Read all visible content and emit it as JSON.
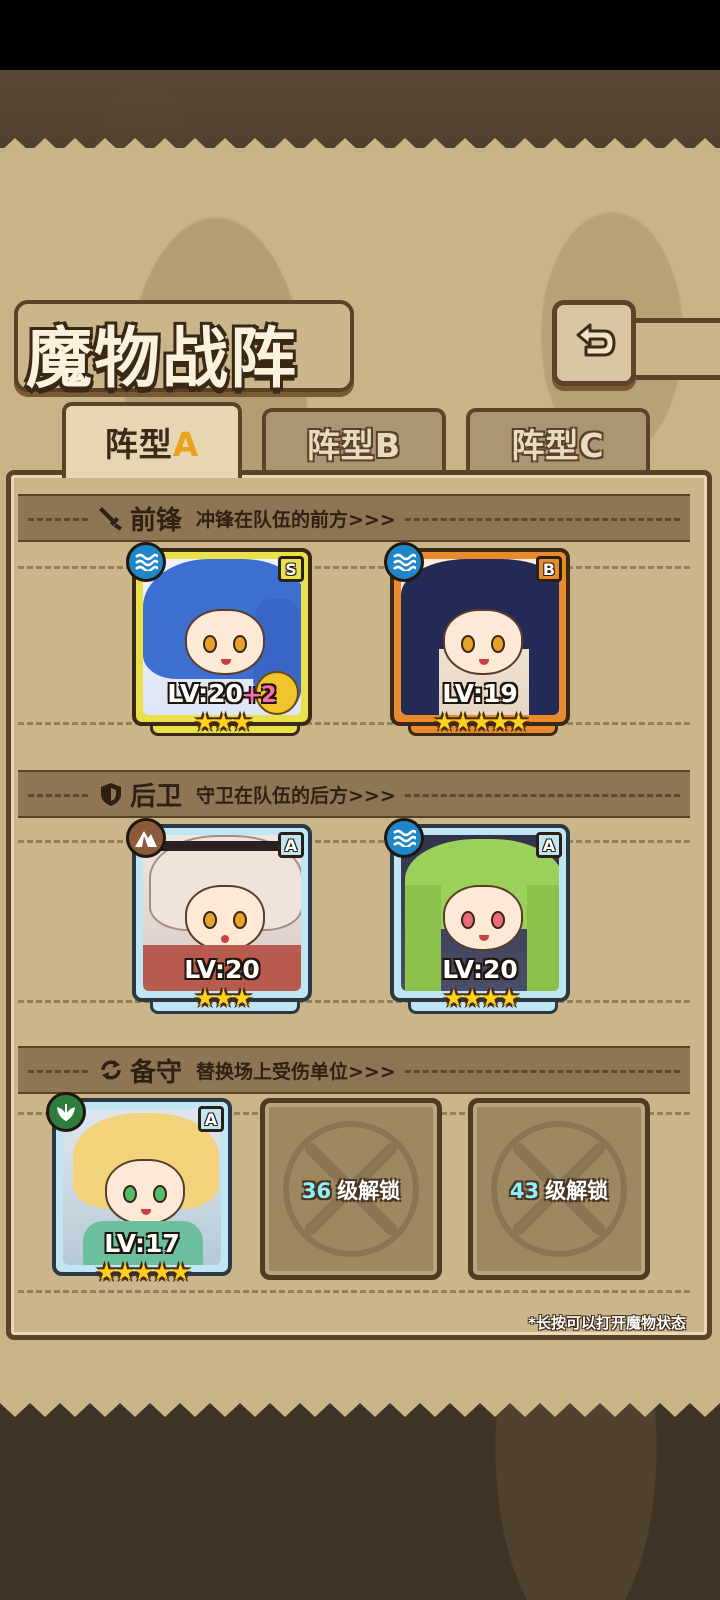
{
  "title": "魔物战阵",
  "tabs": [
    {
      "label": "阵型",
      "letter": "A",
      "active": true
    },
    {
      "label": "阵型",
      "letter": "B",
      "active": false
    },
    {
      "label": "阵型",
      "letter": "C",
      "active": false
    }
  ],
  "sections": {
    "front": {
      "title": "前锋",
      "subtitle": "冲锋在队伍的前方>>>",
      "icon": "sword-icon"
    },
    "rear": {
      "title": "后卫",
      "subtitle": "守卫在队伍的后方>>>",
      "icon": "shield-icon"
    },
    "reserve": {
      "title": "备守",
      "subtitle": "替换场上受伤单位>>>",
      "icon": "swap-icon"
    }
  },
  "units": {
    "front_1": {
      "rank": "S",
      "level": "LV:20",
      "bonus": "+2",
      "stars": "★★★",
      "star_count": 3,
      "element": "water-icon"
    },
    "front_2": {
      "rank": "B",
      "level": "LV:19",
      "bonus": "",
      "stars": "★★★★★",
      "star_count": 5,
      "element": "water-icon"
    },
    "rear_1": {
      "rank": "A",
      "level": "LV:20",
      "bonus": "",
      "stars": "★★★",
      "star_count": 3,
      "element": "mountain-icon"
    },
    "rear_2": {
      "rank": "A",
      "level": "LV:20",
      "bonus": "",
      "stars": "★★★★",
      "star_count": 4,
      "element": "water-icon"
    },
    "reserve_1": {
      "rank": "A",
      "level": "LV:17",
      "bonus": "",
      "stars": "★★★★★",
      "star_count": 5,
      "element": "leaf-icon"
    }
  },
  "locked_slots": [
    {
      "level": "36",
      "text": "级解锁"
    },
    {
      "level": "43",
      "text": "级解锁"
    }
  ],
  "hint": "*长按可以打开魔物状态",
  "colors": {
    "parchment": "#c9b488",
    "border": "#5b4329",
    "rank_s": "#e9e04a",
    "rank_b": "#e98a2d",
    "rank_a": "#bfe6f2",
    "star": "#ffd21f",
    "water": "#1f86c9",
    "mountain": "#8b5a3a",
    "leaf": "#2f7d3b"
  }
}
